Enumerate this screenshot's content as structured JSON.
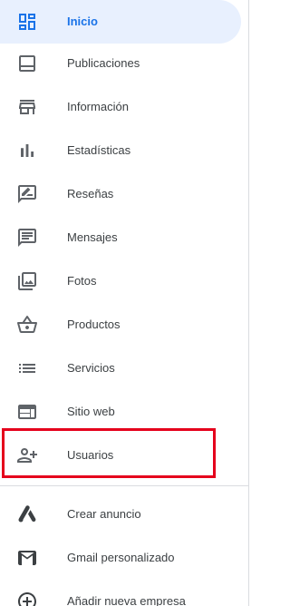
{
  "nav": {
    "items": [
      {
        "label": "Inicio",
        "icon": "dashboard-icon",
        "active": true
      },
      {
        "label": "Publicaciones",
        "icon": "posts-icon"
      },
      {
        "label": "Información",
        "icon": "storefront-icon"
      },
      {
        "label": "Estadísticas",
        "icon": "bar-chart-icon"
      },
      {
        "label": "Reseñas",
        "icon": "review-icon"
      },
      {
        "label": "Mensajes",
        "icon": "message-icon"
      },
      {
        "label": "Fotos",
        "icon": "photos-icon"
      },
      {
        "label": "Productos",
        "icon": "basket-icon"
      },
      {
        "label": "Servicios",
        "icon": "list-icon"
      },
      {
        "label": "Sitio web",
        "icon": "website-icon"
      },
      {
        "label": "Usuarios",
        "icon": "add-user-icon",
        "highlighted": true
      }
    ]
  },
  "secondary": {
    "items": [
      {
        "label": "Crear anuncio",
        "icon": "google-ads-icon"
      },
      {
        "label": "Gmail personalizado",
        "icon": "gmail-icon"
      },
      {
        "label": "Añadir nueva empresa",
        "icon": "add-circle-icon"
      }
    ]
  },
  "colors": {
    "accent": "#1a73e8",
    "active_bg": "#e8f0fe",
    "icon": "#5f6368",
    "text": "#3c4043",
    "highlight_border": "#e5001c",
    "divider": "#dadce0"
  }
}
